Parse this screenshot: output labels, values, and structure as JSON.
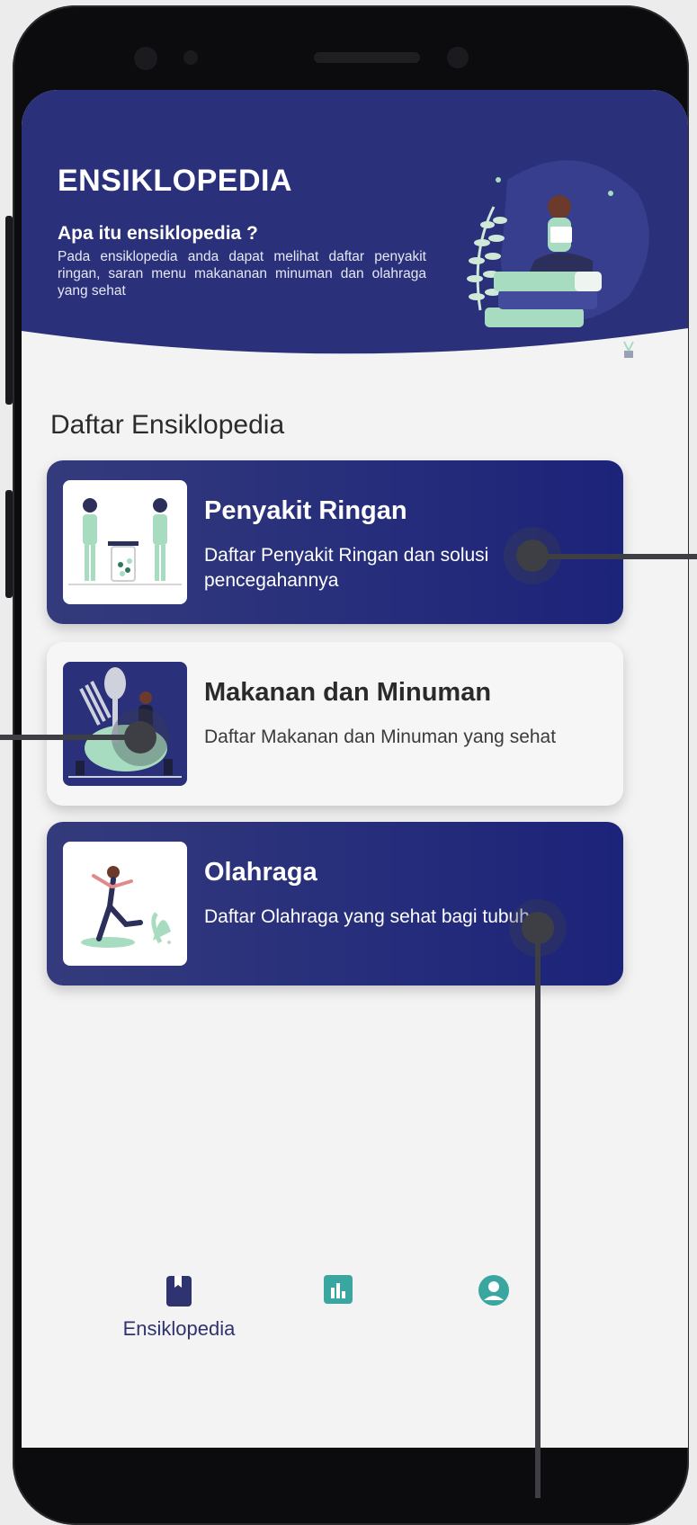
{
  "hero": {
    "title": "ENSIKLOPEDIA",
    "subtitle": "Apa itu ensiklopedia ?",
    "description": "Pada ensiklopedia anda dapat melihat daftar penyakit ringan, saran menu makananan minuman dan olahraga yang sehat"
  },
  "section_title": "Daftar Ensiklopedia",
  "cards": [
    {
      "title": "Penyakit Ringan",
      "description": "Daftar Penyakit Ringan dan solusi pencegahannya",
      "style": "dark"
    },
    {
      "title": "Makanan dan Minuman",
      "description": "Daftar Makanan dan Minuman yang sehat",
      "style": "light"
    },
    {
      "title": "Olahraga",
      "description": "Daftar Olahraga yang sehat bagi tubuh",
      "style": "dark"
    }
  ],
  "bottom_nav": {
    "items": [
      {
        "label": "Ensiklopedia",
        "icon": "book-icon",
        "active": true
      },
      {
        "label": "",
        "icon": "bar-chart-icon",
        "active": false
      },
      {
        "label": "",
        "icon": "account-icon",
        "active": false
      }
    ]
  },
  "colors": {
    "primary": "#2a307a",
    "accent_green": "#9fdcb6",
    "background": "#f3f3f3",
    "nav_teal": "#3aa6a0"
  }
}
